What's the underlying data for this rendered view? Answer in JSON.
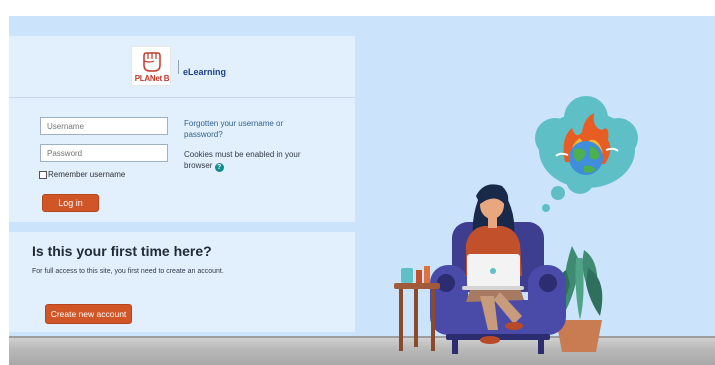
{
  "brand": {
    "logo_text": "PLANet B",
    "site_name": "eLearning",
    "logo_icon": "raised-fist-icon"
  },
  "login": {
    "username_placeholder": "Username",
    "password_placeholder": "Password",
    "remember_label": "Remember username",
    "login_button": "Log in",
    "forgot_link": "Forgotten your username or password?",
    "cookies_notice": "Cookies must be enabled in your browser",
    "help_icon": "question-circle-icon"
  },
  "signup": {
    "title": "Is this your first time here?",
    "description": "For full access to this site, you first need to create an account.",
    "create_button": "Create new account"
  },
  "colors": {
    "accent": "#d05527",
    "background": "#cce4fb",
    "card": "#e2effc",
    "link": "#34618f"
  }
}
